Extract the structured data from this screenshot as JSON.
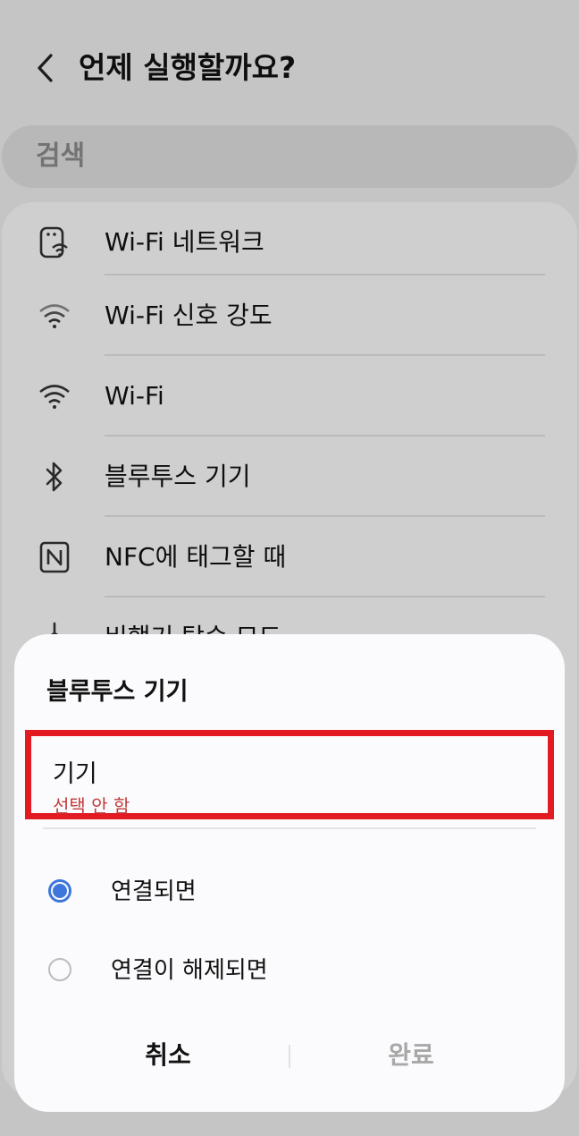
{
  "header": {
    "title": "언제 실행할까요?"
  },
  "search": {
    "placeholder": "검색"
  },
  "list": {
    "items": [
      {
        "label": "Wi-Fi 네트워크",
        "icon": "wifi-network-icon"
      },
      {
        "label": "Wi-Fi 신호 강도",
        "icon": "wifi-signal-icon"
      },
      {
        "label": "Wi-Fi",
        "icon": "wifi-icon"
      },
      {
        "label": "블루투스 기기",
        "icon": "bluetooth-icon"
      },
      {
        "label": "NFC에 태그할 때",
        "icon": "nfc-icon"
      },
      {
        "label": "비행기 탑승 모드",
        "icon": "airplane-icon"
      }
    ]
  },
  "dialog": {
    "title": "블루투스 기기",
    "device": {
      "label": "기기",
      "value": "선택 안 함"
    },
    "options": [
      {
        "label": "연결되면",
        "selected": true
      },
      {
        "label": "연결이 해제되면",
        "selected": false
      }
    ],
    "cancel_label": "취소",
    "done_label": "완료"
  },
  "colors": {
    "accent": "#3e76db",
    "highlight_border": "#e21b22",
    "value_text": "#c23b3b"
  }
}
